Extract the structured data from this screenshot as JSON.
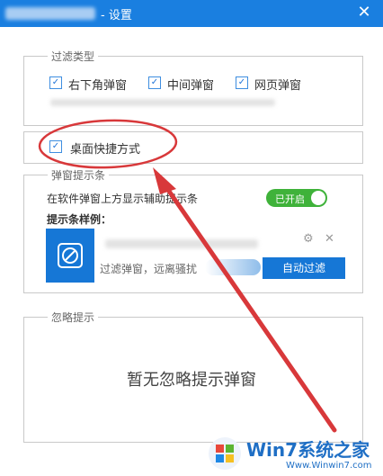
{
  "window": {
    "title": "- 设置",
    "close_glyph": "✕"
  },
  "filter_type": {
    "legend": "过滤类型",
    "options": [
      {
        "label": "右下角弹窗",
        "checked": true
      },
      {
        "label": "中间弹窗",
        "checked": true
      },
      {
        "label": "网页弹窗",
        "checked": true
      }
    ]
  },
  "desktop_shortcut": {
    "label": "桌面快捷方式",
    "checked": true
  },
  "popup_bar": {
    "legend": "弹窗提示条",
    "description": "在软件弹窗上方显示辅助提示条",
    "toggle_label": "已开启",
    "toggle_on": true,
    "sample_heading": "提示条样例：",
    "sample_subtitle": "过滤弹窗，远离骚扰",
    "auto_filter_label": "自动过滤",
    "settings_glyph": "⚙",
    "dismiss_glyph": "✕"
  },
  "ignore": {
    "legend": "忽略提示",
    "empty_text": "暂无忽略提示弹窗"
  },
  "watermark": {
    "brand": "Win7系统之家",
    "url": "Www.Winwin7.com"
  },
  "colors": {
    "titlebar": "#1a7fe0",
    "accent_blue": "#1677d6",
    "toggle_green": "#3fb23a",
    "annotation_red": "#d8383a"
  }
}
